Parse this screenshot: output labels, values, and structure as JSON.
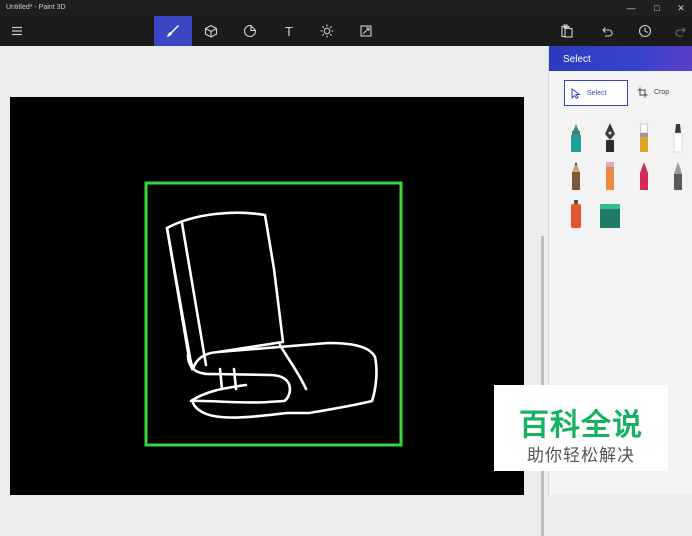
{
  "window": {
    "title": "Untitled* - Paint 3D",
    "controls": {
      "minimize": "—",
      "maximize": "□",
      "close": "✕"
    }
  },
  "toolbar": {
    "tools": [
      {
        "name": "menu",
        "icon": "hamburger-icon"
      },
      {
        "name": "brushes",
        "icon": "brush-icon",
        "active": true
      },
      {
        "name": "3d-shapes",
        "icon": "cube-icon"
      },
      {
        "name": "stickers",
        "icon": "sticker-icon"
      },
      {
        "name": "text",
        "icon": "text-icon",
        "glyph": "T"
      },
      {
        "name": "effects",
        "icon": "sun-icon"
      },
      {
        "name": "canvas",
        "icon": "canvas-resize-icon"
      }
    ],
    "right": [
      {
        "name": "paste",
        "icon": "paste-icon"
      },
      {
        "name": "undo",
        "icon": "undo-icon"
      },
      {
        "name": "history",
        "icon": "history-icon"
      },
      {
        "name": "redo",
        "icon": "redo-icon"
      }
    ],
    "accent": "#3d46c2"
  },
  "panel": {
    "header": "Select",
    "tabs": [
      {
        "label": "Select",
        "icon": "cursor-icon",
        "active": true
      },
      {
        "label": "Crop",
        "icon": "crop-icon",
        "active": false
      }
    ],
    "brushes": [
      {
        "name": "marker",
        "color": "#1ba39a"
      },
      {
        "name": "calligraphy-pen",
        "color": "#3a3a3a"
      },
      {
        "name": "oil-brush",
        "color": "#e0a52b"
      },
      {
        "name": "watercolor",
        "color": "#3a3a3a"
      },
      {
        "name": "pixel-pen",
        "color": "#7a5a3a"
      },
      {
        "name": "pencil",
        "color": "#f08a3b"
      },
      {
        "name": "eraser",
        "color": "#d42a5a"
      },
      {
        "name": "crayon",
        "color": "#5a5a5a"
      },
      {
        "name": "spray-can",
        "color": "#e0552b"
      },
      {
        "name": "fill-bucket",
        "color": "#1f7a6a"
      }
    ]
  },
  "canvas": {
    "background": "#000000",
    "selection_color": "#39d639",
    "stroke_color": "#ffffff"
  },
  "watermark": {
    "main": "百科全说",
    "sub": "助你轻松解决"
  }
}
